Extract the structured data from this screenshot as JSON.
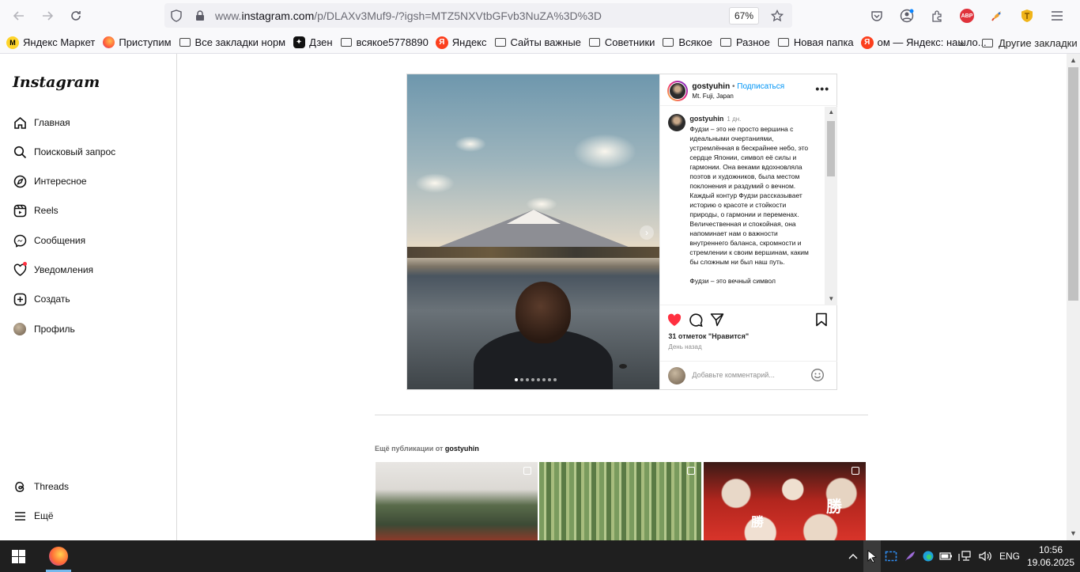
{
  "browser": {
    "url_prefix": "www.",
    "url_host": "instagram.com",
    "url_path": "/p/DLAXv3Muf9-/?igsh=MTZ5NXVtbGFvb3NuZA%3D%3D",
    "zoom": "67%",
    "abp_label": "ABP"
  },
  "bookmarks": {
    "items": [
      {
        "label": "Яндекс Маркет",
        "icon": "yandex-market-icon"
      },
      {
        "label": "Приступим",
        "icon": "firefox-icon"
      },
      {
        "label": "Все закладки норм",
        "icon": "folder-icon"
      },
      {
        "label": "Дзен",
        "icon": "dzen-icon"
      },
      {
        "label": "всякое5778890",
        "icon": "folder-icon"
      },
      {
        "label": "Яндекс",
        "icon": "yandex-icon"
      },
      {
        "label": "Сайты важные",
        "icon": "folder-icon"
      },
      {
        "label": "Советники",
        "icon": "folder-icon"
      },
      {
        "label": "Всякое",
        "icon": "folder-icon"
      },
      {
        "label": "Разное",
        "icon": "folder-icon"
      },
      {
        "label": "Новая папка",
        "icon": "folder-icon"
      },
      {
        "label": "ом — Яндекс: нашло...",
        "icon": "yandex-icon"
      }
    ],
    "overflow": "»",
    "other": "Другие закладки"
  },
  "sidebar": {
    "logo": "Instagram",
    "items": [
      {
        "label": "Главная",
        "icon": "home-icon"
      },
      {
        "label": "Поисковый запрос",
        "icon": "search-icon"
      },
      {
        "label": "Интересное",
        "icon": "compass-icon"
      },
      {
        "label": "Reels",
        "icon": "reels-icon"
      },
      {
        "label": "Сообщения",
        "icon": "messenger-icon"
      },
      {
        "label": "Уведомления",
        "icon": "heart-icon"
      },
      {
        "label": "Создать",
        "icon": "plus-square-icon"
      },
      {
        "label": "Профиль",
        "icon": "avatar"
      }
    ],
    "bottom": [
      {
        "label": "Threads",
        "icon": "threads-icon"
      },
      {
        "label": "Ещё",
        "icon": "menu-icon"
      }
    ]
  },
  "post": {
    "username": "gostyuhin",
    "follow_sep": " • ",
    "follow": "Подписаться",
    "location": "Mt. Fuji, Japan",
    "more": "•••",
    "caption_user": "gostyuhin",
    "caption_time": "1 дн.",
    "caption_p1": "Фудзи – это не просто вершина с идеальными очертаниями, устремлённая в бескрайнее небо, это сердце Японии, символ её силы и гармонии. Она веками вдохновляла поэтов и художников, была местом поклонения и раздумий о вечном. Каждый контур Фудзи рассказывает историю о красоте и стойкости природы, о гармонии и переменах. Величественная и спокойная, она напоминает нам о важности внутреннего баланса, скромности и стремлении к своим вершинам, каким бы сложным ни был наш путь.",
    "caption_p2": "Фудзи – это вечный символ",
    "likes": "31 отметок \"Нравится\"",
    "when": "День назад",
    "comment_placeholder": "Добавьте комментарий...",
    "carousel_count": 8,
    "carousel_active": 0,
    "colors": {
      "like": "#ff3040",
      "follow": "#0095f6"
    }
  },
  "more_posts": {
    "prefix": "Ещё публикации от ",
    "user": "gostyuhin",
    "kanji": "勝"
  },
  "taskbar": {
    "lang": "ENG",
    "time": "10:56",
    "date": "19.06.2025"
  }
}
